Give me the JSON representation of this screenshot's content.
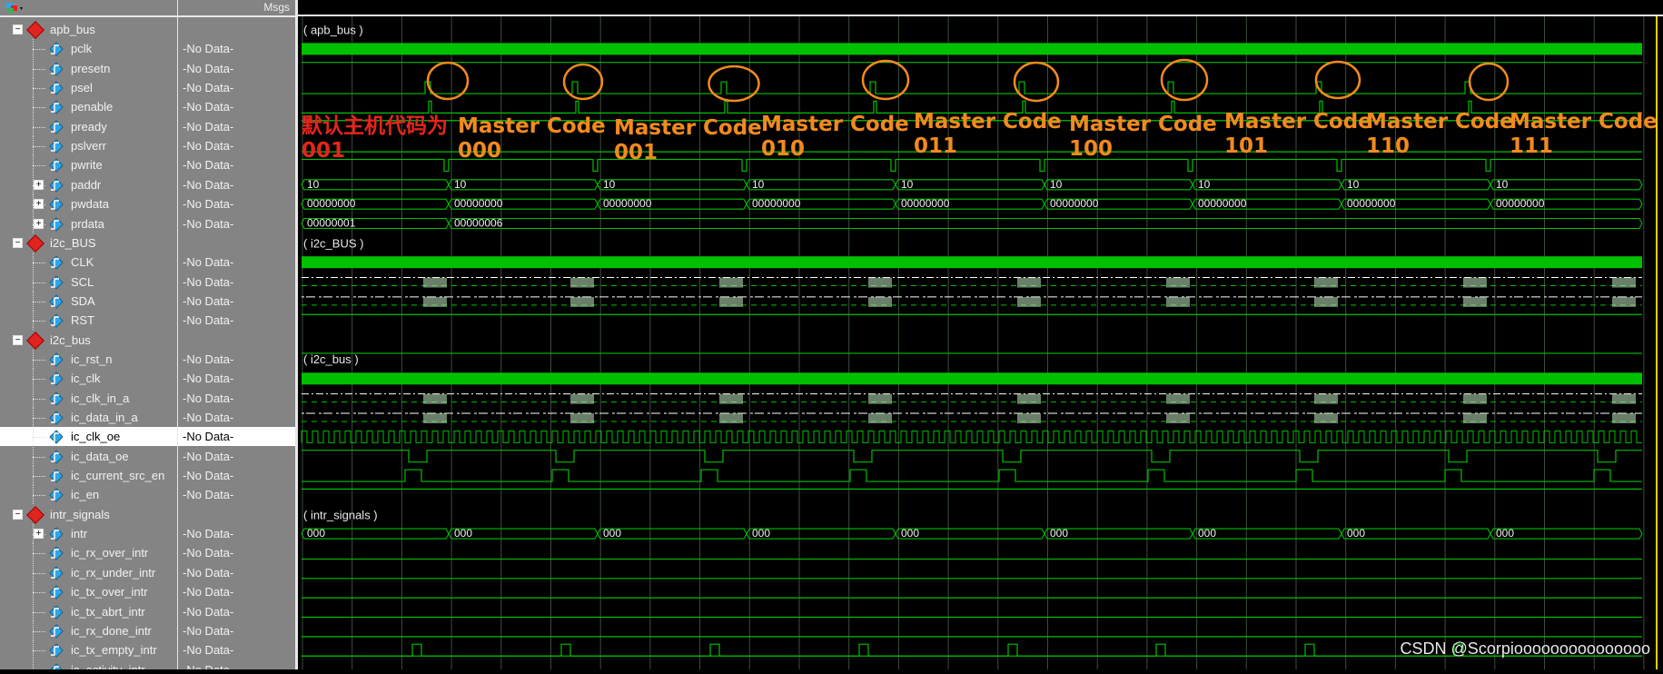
{
  "header": {
    "msgs_label": "Msgs"
  },
  "signals": [
    {
      "name": "apb_bus",
      "type": "group",
      "depth": 0,
      "expand": "-",
      "msg": ""
    },
    {
      "name": "pclk",
      "type": "sig",
      "depth": 1,
      "msg": "-No Data-"
    },
    {
      "name": "presetn",
      "type": "sig",
      "depth": 1,
      "msg": "-No Data-"
    },
    {
      "name": "psel",
      "type": "sig",
      "depth": 1,
      "msg": "-No Data-"
    },
    {
      "name": "penable",
      "type": "sig",
      "depth": 1,
      "msg": "-No Data-"
    },
    {
      "name": "pready",
      "type": "sig",
      "depth": 1,
      "msg": "-No Data-"
    },
    {
      "name": "pslverr",
      "type": "sig",
      "depth": 1,
      "msg": "-No Data-"
    },
    {
      "name": "pwrite",
      "type": "sig",
      "depth": 1,
      "msg": "-No Data-"
    },
    {
      "name": "paddr",
      "type": "bus",
      "depth": 1,
      "expand": "+",
      "msg": "-No Data-"
    },
    {
      "name": "pwdata",
      "type": "bus",
      "depth": 1,
      "expand": "+",
      "msg": "-No Data-"
    },
    {
      "name": "prdata",
      "type": "bus",
      "depth": 1,
      "expand": "+",
      "msg": "-No Data-"
    },
    {
      "name": "i2c_BUS",
      "type": "group",
      "depth": 0,
      "expand": "-",
      "msg": ""
    },
    {
      "name": "CLK",
      "type": "sig",
      "depth": 1,
      "msg": "-No Data-"
    },
    {
      "name": "SCL",
      "type": "sig",
      "depth": 1,
      "msg": "-No Data-"
    },
    {
      "name": "SDA",
      "type": "sig",
      "depth": 1,
      "msg": "-No Data-"
    },
    {
      "name": "RST",
      "type": "sig",
      "depth": 1,
      "msg": "-No Data-"
    },
    {
      "name": "i2c_bus",
      "type": "group",
      "depth": 0,
      "expand": "-",
      "msg": ""
    },
    {
      "name": "ic_rst_n",
      "type": "sig",
      "depth": 1,
      "msg": "-No Data-"
    },
    {
      "name": "ic_clk",
      "type": "sig",
      "depth": 1,
      "msg": "-No Data-"
    },
    {
      "name": "ic_clk_in_a",
      "type": "sig",
      "depth": 1,
      "msg": "-No Data-"
    },
    {
      "name": "ic_data_in_a",
      "type": "sig",
      "depth": 1,
      "msg": "-No Data-"
    },
    {
      "name": "ic_clk_oe",
      "type": "sig",
      "depth": 1,
      "msg": "-No Data-",
      "selected": true
    },
    {
      "name": "ic_data_oe",
      "type": "sig",
      "depth": 1,
      "msg": "-No Data-"
    },
    {
      "name": "ic_current_src_en",
      "type": "sig",
      "depth": 1,
      "msg": "-No Data-"
    },
    {
      "name": "ic_en",
      "type": "sig",
      "depth": 1,
      "msg": "-No Data-"
    },
    {
      "name": "intr_signals",
      "type": "group",
      "depth": 0,
      "expand": "-",
      "msg": ""
    },
    {
      "name": "intr",
      "type": "bus",
      "depth": 1,
      "expand": "+",
      "msg": "-No Data-"
    },
    {
      "name": "ic_rx_over_intr",
      "type": "sig",
      "depth": 1,
      "msg": "-No Data-"
    },
    {
      "name": "ic_rx_under_intr",
      "type": "sig",
      "depth": 1,
      "msg": "-No Data-"
    },
    {
      "name": "ic_tx_over_intr",
      "type": "sig",
      "depth": 1,
      "msg": "-No Data-"
    },
    {
      "name": "ic_tx_abrt_intr",
      "type": "sig",
      "depth": 1,
      "msg": "-No Data-"
    },
    {
      "name": "ic_rx_done_intr",
      "type": "sig",
      "depth": 1,
      "msg": "-No Data-"
    },
    {
      "name": "ic_tx_empty_intr",
      "type": "sig",
      "depth": 1,
      "msg": "-No Data-"
    },
    {
      "name": "ic_activity_intr",
      "type": "sig",
      "depth": 1,
      "msg": "-No Data-"
    }
  ],
  "wave_labels": {
    "apb_bus": "( apb_bus )",
    "i2c_BUS": "( i2c_BUS )",
    "i2c_bus": "( i2c_bus )",
    "intr_signals": "( intr_signals )"
  },
  "bus_values": {
    "paddr": [
      "10",
      "10",
      "10",
      "10",
      "10",
      "10",
      "10",
      "10",
      "10"
    ],
    "pwdata": [
      "00000000",
      "00000000",
      "00000000",
      "00000000",
      "00000000",
      "00000000",
      "00000000",
      "00000000",
      "00000000"
    ],
    "prdata": [
      "00000001",
      "00000006"
    ],
    "intr": [
      "000",
      "000",
      "000",
      "000",
      "000",
      "000",
      "000",
      "000",
      "000"
    ]
  },
  "annotations": {
    "default_label": "默认主机代码为",
    "default_code": "001",
    "master_label": "Master Code",
    "master_codes": [
      "000",
      "001",
      "010",
      "011",
      "100",
      "101",
      "110",
      "111"
    ]
  },
  "watermark": "CSDN @Scorpiooooooooooooooo",
  "colors": {
    "signal": "#00c000",
    "grid": "#3a4f3a",
    "circle": "#f28a1e",
    "cursor": "#f0d000",
    "group_icon": "#e0241f",
    "signal_icon": "#2fa6e6"
  }
}
